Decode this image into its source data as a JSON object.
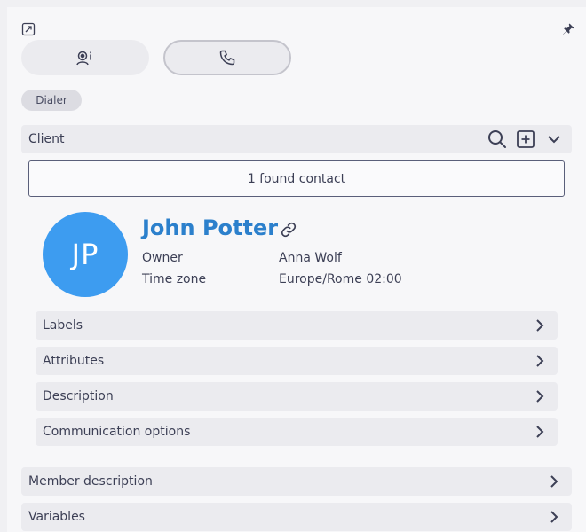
{
  "header": {
    "expand_icon": "expand-icon",
    "pin_icon": "pin-icon"
  },
  "tabs": [
    {
      "icon": "agent-info-icon",
      "active": false
    },
    {
      "icon": "phone-icon",
      "active": true
    }
  ],
  "chip": {
    "label": "Dialer"
  },
  "client_section": {
    "title": "Client",
    "found_text": "1 found contact",
    "contact": {
      "initials": "JP",
      "name": "John Potter",
      "avatar_color": "#3d9cf0",
      "name_color": "#2c80cc",
      "fields": [
        {
          "label": "Owner",
          "value": "Anna Wolf"
        },
        {
          "label": "Time zone",
          "value": "Europe/Rome 02:00"
        }
      ]
    },
    "subsections": [
      {
        "title": "Labels"
      },
      {
        "title": "Attributes"
      },
      {
        "title": "Description"
      },
      {
        "title": "Communication options"
      }
    ]
  },
  "sections": [
    {
      "title": "Member description"
    },
    {
      "title": "Variables"
    }
  ]
}
